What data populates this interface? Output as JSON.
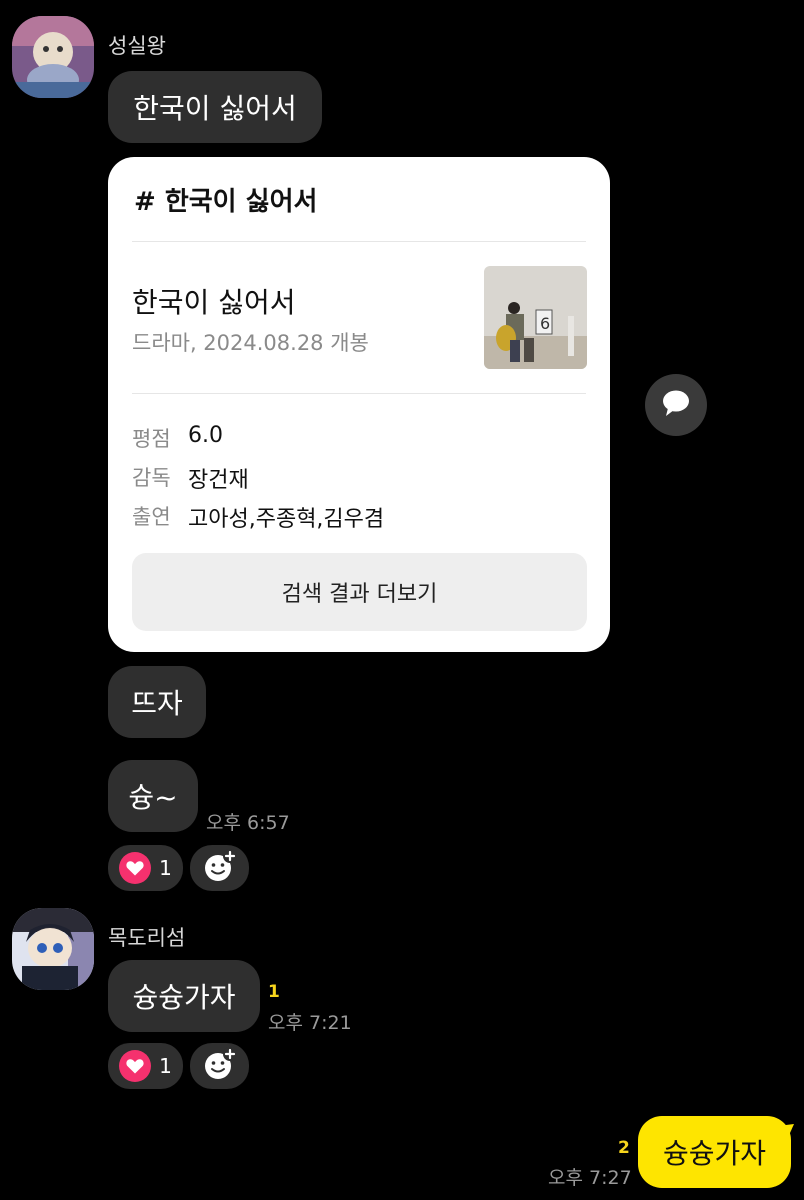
{
  "colors": {
    "background": "#000000",
    "bubble_other": "#2f2f2f",
    "bubble_mine": "#fee500",
    "heart": "#f5316e",
    "unread": "#f7d51d"
  },
  "messages": {
    "sender1": {
      "name": "성실왕"
    },
    "msg1": {
      "text": "한국이 싫어서"
    },
    "card": {
      "header": "# 한국이 싫어서",
      "title": "한국이 싫어서",
      "subtitle": "드라마, 2024.08.28 개봉",
      "rating_label": "평점",
      "rating_value": "6.0",
      "director_label": "감독",
      "director_value": "장건재",
      "cast_label": "출연",
      "cast_value": "고아성,주종혁,김우겸",
      "more_button": "검색 결과 더보기"
    },
    "msg2": {
      "text": "뜨자"
    },
    "msg3": {
      "text": "슝~",
      "time": "오후 6:57",
      "heart_count": "1"
    },
    "sender2": {
      "name": "목도리섬"
    },
    "msg4": {
      "text": "슝슝가자",
      "unread": "1",
      "time": "오후 7:21",
      "heart_count": "1"
    },
    "msg5": {
      "text": "슝슝가자",
      "unread": "2",
      "time": "오후 7:27"
    }
  },
  "icons": {
    "share": "speech-bubble-icon",
    "add_reaction": "smiley-plus-icon",
    "heart": "heart-icon"
  }
}
